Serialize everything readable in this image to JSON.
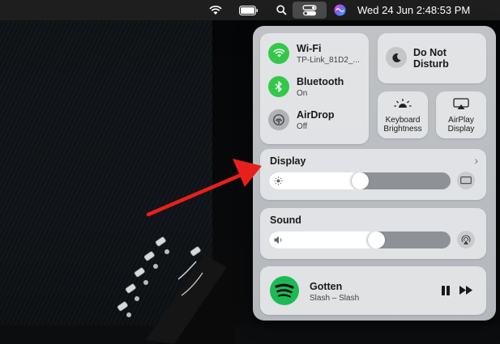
{
  "menubar": {
    "datetime": "Wed 24 Jun  2:48:53 PM"
  },
  "control_center": {
    "wifi": {
      "label": "Wi-Fi",
      "status": "TP-Link_81D2_..."
    },
    "bluetooth": {
      "label": "Bluetooth",
      "status": "On"
    },
    "airdrop": {
      "label": "AirDrop",
      "status": "Off"
    },
    "do_not_disturb": {
      "label": "Do Not Disturb"
    },
    "keyboard_brightness": {
      "label": "Keyboard Brightness"
    },
    "airplay_display": {
      "label": "AirPlay Display"
    },
    "display": {
      "label": "Display",
      "brightness": 0.5
    },
    "sound": {
      "label": "Sound",
      "volume": 0.6
    },
    "now_playing": {
      "title": "Gotten",
      "artist": "Slash – Slash"
    }
  },
  "colors": {
    "toggle_on": "#33c84a",
    "annotation_arrow": "#e8201c",
    "spotify_green": "#1db954"
  }
}
